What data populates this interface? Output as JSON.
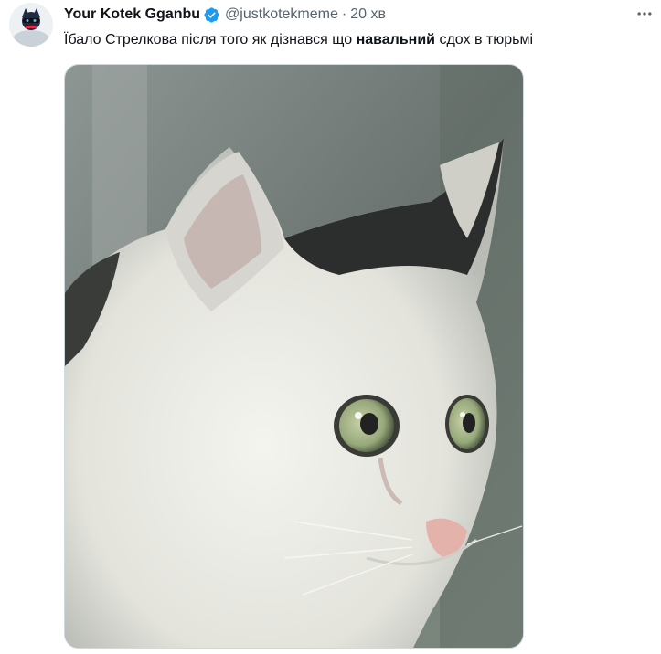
{
  "author": {
    "display_name": "Your Kotek Gganbu",
    "handle": "@justkotekmeme",
    "separator": "·",
    "timestamp": "20 хв",
    "verified": true,
    "verified_color": "#1d9bf0"
  },
  "tweet": {
    "text_before": "Їбало Стрелкова після того як дізнався що ",
    "text_bold": "навальний",
    "text_after": " сдох в тюрьмі"
  },
  "media": {
    "type": "photo",
    "subject": "white-and-black cat with wide teary eyes"
  },
  "icons": {
    "more": "more-horizontal-icon",
    "verified": "verified-badge-icon"
  },
  "colors": {
    "text_primary": "#0f1419",
    "text_secondary": "#536471",
    "accent": "#1d9bf0"
  }
}
